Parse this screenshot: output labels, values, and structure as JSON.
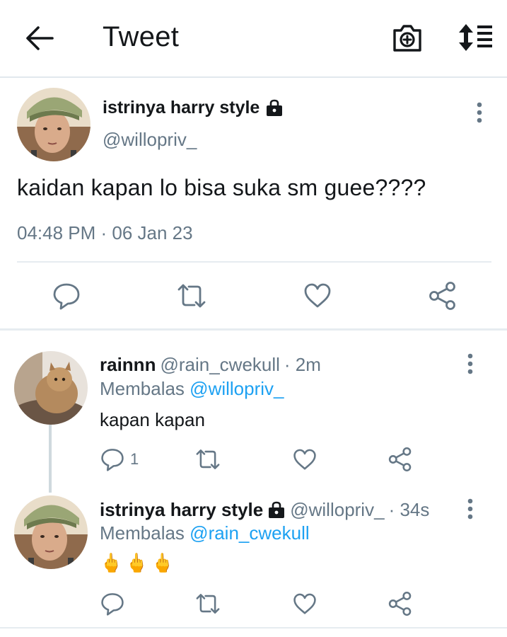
{
  "header": {
    "title": "Tweet"
  },
  "main_tweet": {
    "display_name": "istrinya harry style",
    "handle": "@willopriv_",
    "text": "kaidan kapan lo bisa suka sm guee????",
    "timestamp": "04:48 PM · 06 Jan 23"
  },
  "replies": [
    {
      "display_name": "rainnn",
      "handle": "@rain_cwekull",
      "time": "· 2m",
      "reply_prefix": "Membalas",
      "reply_to": "@willopriv_",
      "text": "kapan kapan",
      "reply_count": "1"
    },
    {
      "display_name": "istrinya harry style",
      "handle": "@willopriv_",
      "time": "· 34s",
      "reply_prefix": "Membalas",
      "reply_to": "@rain_cwekull",
      "text": "🖕🖕🖕"
    }
  ],
  "colors": {
    "accent": "#1da1f2",
    "muted": "#657786",
    "text": "#14171a",
    "divider": "#e6ecf0"
  }
}
